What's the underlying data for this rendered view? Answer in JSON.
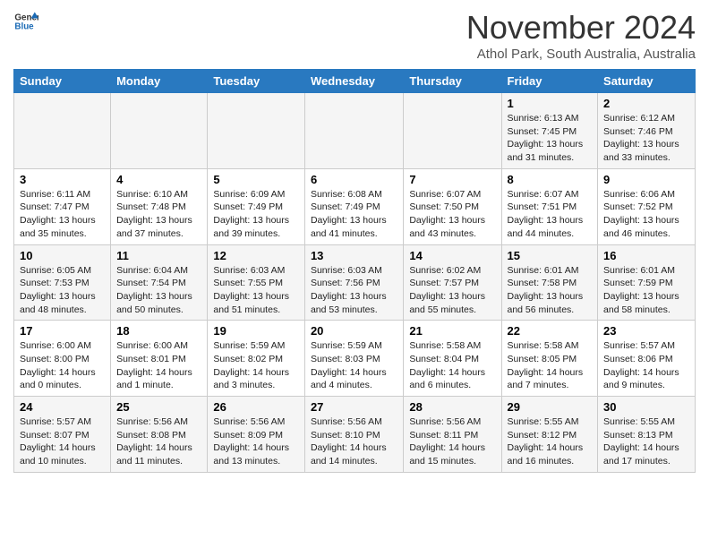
{
  "header": {
    "logo_line1": "General",
    "logo_line2": "Blue",
    "month": "November 2024",
    "location": "Athol Park, South Australia, Australia"
  },
  "weekdays": [
    "Sunday",
    "Monday",
    "Tuesday",
    "Wednesday",
    "Thursday",
    "Friday",
    "Saturday"
  ],
  "weeks": [
    [
      {
        "day": "",
        "text": ""
      },
      {
        "day": "",
        "text": ""
      },
      {
        "day": "",
        "text": ""
      },
      {
        "day": "",
        "text": ""
      },
      {
        "day": "",
        "text": ""
      },
      {
        "day": "1",
        "text": "Sunrise: 6:13 AM\nSunset: 7:45 PM\nDaylight: 13 hours and 31 minutes."
      },
      {
        "day": "2",
        "text": "Sunrise: 6:12 AM\nSunset: 7:46 PM\nDaylight: 13 hours and 33 minutes."
      }
    ],
    [
      {
        "day": "3",
        "text": "Sunrise: 6:11 AM\nSunset: 7:47 PM\nDaylight: 13 hours and 35 minutes."
      },
      {
        "day": "4",
        "text": "Sunrise: 6:10 AM\nSunset: 7:48 PM\nDaylight: 13 hours and 37 minutes."
      },
      {
        "day": "5",
        "text": "Sunrise: 6:09 AM\nSunset: 7:49 PM\nDaylight: 13 hours and 39 minutes."
      },
      {
        "day": "6",
        "text": "Sunrise: 6:08 AM\nSunset: 7:49 PM\nDaylight: 13 hours and 41 minutes."
      },
      {
        "day": "7",
        "text": "Sunrise: 6:07 AM\nSunset: 7:50 PM\nDaylight: 13 hours and 43 minutes."
      },
      {
        "day": "8",
        "text": "Sunrise: 6:07 AM\nSunset: 7:51 PM\nDaylight: 13 hours and 44 minutes."
      },
      {
        "day": "9",
        "text": "Sunrise: 6:06 AM\nSunset: 7:52 PM\nDaylight: 13 hours and 46 minutes."
      }
    ],
    [
      {
        "day": "10",
        "text": "Sunrise: 6:05 AM\nSunset: 7:53 PM\nDaylight: 13 hours and 48 minutes."
      },
      {
        "day": "11",
        "text": "Sunrise: 6:04 AM\nSunset: 7:54 PM\nDaylight: 13 hours and 50 minutes."
      },
      {
        "day": "12",
        "text": "Sunrise: 6:03 AM\nSunset: 7:55 PM\nDaylight: 13 hours and 51 minutes."
      },
      {
        "day": "13",
        "text": "Sunrise: 6:03 AM\nSunset: 7:56 PM\nDaylight: 13 hours and 53 minutes."
      },
      {
        "day": "14",
        "text": "Sunrise: 6:02 AM\nSunset: 7:57 PM\nDaylight: 13 hours and 55 minutes."
      },
      {
        "day": "15",
        "text": "Sunrise: 6:01 AM\nSunset: 7:58 PM\nDaylight: 13 hours and 56 minutes."
      },
      {
        "day": "16",
        "text": "Sunrise: 6:01 AM\nSunset: 7:59 PM\nDaylight: 13 hours and 58 minutes."
      }
    ],
    [
      {
        "day": "17",
        "text": "Sunrise: 6:00 AM\nSunset: 8:00 PM\nDaylight: 14 hours and 0 minutes."
      },
      {
        "day": "18",
        "text": "Sunrise: 6:00 AM\nSunset: 8:01 PM\nDaylight: 14 hours and 1 minute."
      },
      {
        "day": "19",
        "text": "Sunrise: 5:59 AM\nSunset: 8:02 PM\nDaylight: 14 hours and 3 minutes."
      },
      {
        "day": "20",
        "text": "Sunrise: 5:59 AM\nSunset: 8:03 PM\nDaylight: 14 hours and 4 minutes."
      },
      {
        "day": "21",
        "text": "Sunrise: 5:58 AM\nSunset: 8:04 PM\nDaylight: 14 hours and 6 minutes."
      },
      {
        "day": "22",
        "text": "Sunrise: 5:58 AM\nSunset: 8:05 PM\nDaylight: 14 hours and 7 minutes."
      },
      {
        "day": "23",
        "text": "Sunrise: 5:57 AM\nSunset: 8:06 PM\nDaylight: 14 hours and 9 minutes."
      }
    ],
    [
      {
        "day": "24",
        "text": "Sunrise: 5:57 AM\nSunset: 8:07 PM\nDaylight: 14 hours and 10 minutes."
      },
      {
        "day": "25",
        "text": "Sunrise: 5:56 AM\nSunset: 8:08 PM\nDaylight: 14 hours and 11 minutes."
      },
      {
        "day": "26",
        "text": "Sunrise: 5:56 AM\nSunset: 8:09 PM\nDaylight: 14 hours and 13 minutes."
      },
      {
        "day": "27",
        "text": "Sunrise: 5:56 AM\nSunset: 8:10 PM\nDaylight: 14 hours and 14 minutes."
      },
      {
        "day": "28",
        "text": "Sunrise: 5:56 AM\nSunset: 8:11 PM\nDaylight: 14 hours and 15 minutes."
      },
      {
        "day": "29",
        "text": "Sunrise: 5:55 AM\nSunset: 8:12 PM\nDaylight: 14 hours and 16 minutes."
      },
      {
        "day": "30",
        "text": "Sunrise: 5:55 AM\nSunset: 8:13 PM\nDaylight: 14 hours and 17 minutes."
      }
    ]
  ]
}
